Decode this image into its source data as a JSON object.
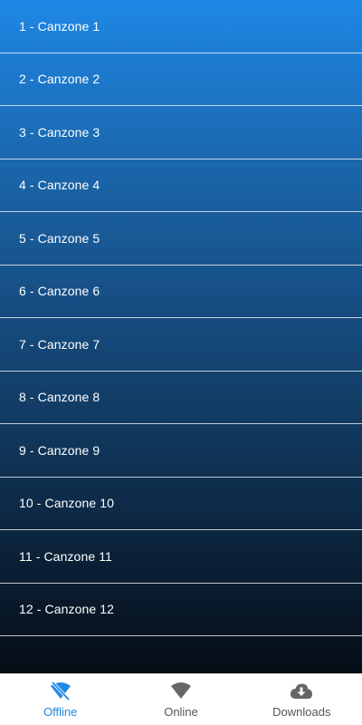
{
  "songs": [
    {
      "label": "1 - Canzone 1"
    },
    {
      "label": "2 - Canzone 2"
    },
    {
      "label": "3 - Canzone 3"
    },
    {
      "label": "4 - Canzone 4"
    },
    {
      "label": "5 - Canzone 5"
    },
    {
      "label": "6 - Canzone 6"
    },
    {
      "label": "7 - Canzone 7"
    },
    {
      "label": "8 - Canzone 8"
    },
    {
      "label": "9 - Canzone 9"
    },
    {
      "label": "10 - Canzone 10"
    },
    {
      "label": "11 - Canzone 11"
    },
    {
      "label": "12 - Canzone 12"
    }
  ],
  "bottom_nav": {
    "items": [
      {
        "label": "Offline",
        "icon": "wifi-off-icon",
        "active": true
      },
      {
        "label": "Online",
        "icon": "wifi-icon",
        "active": false
      },
      {
        "label": "Downloads",
        "icon": "cloud-download-icon",
        "active": false
      }
    ]
  },
  "colors": {
    "accent": "#1e88e5",
    "inactive": "#555555",
    "gradient_top": "#1e88e5",
    "gradient_bottom": "#060d16"
  }
}
